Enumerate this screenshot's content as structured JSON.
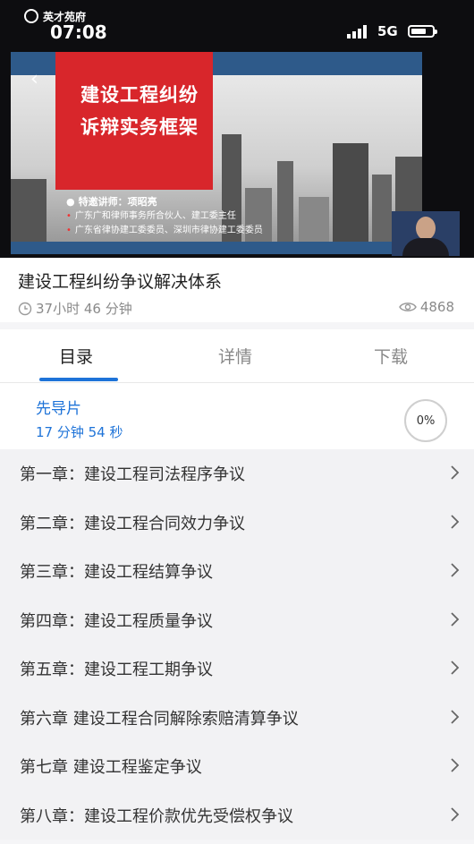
{
  "status_bar": {
    "app_logo_text": "英才苑府",
    "time": "07:08",
    "network": "5G"
  },
  "video": {
    "slide_title_line1": "建设工程纠纷",
    "slide_title_line2": "诉辩实务框架",
    "lecturer_label": "特邀讲师：项昭亮",
    "bullet1": "广东广和律师事务所合伙人、建工委主任",
    "bullet2": "广东省律协建工委委员、深圳市律协建工委委员"
  },
  "course": {
    "title": "建设工程纠纷争议解决体系",
    "duration": "37小时 46 分钟",
    "views": "4868"
  },
  "tabs": [
    {
      "label": "目录",
      "active": true
    },
    {
      "label": "详情",
      "active": false
    },
    {
      "label": "下载",
      "active": false
    }
  ],
  "current_item": {
    "title": "先导片",
    "duration": "17 分钟 54 秒",
    "progress": "0%"
  },
  "chapters": [
    "第一章：建设工程司法程序争议",
    "第二章：建设工程合同效力争议",
    "第三章：建设工程结算争议",
    "第四章：建设工程质量争议",
    "第五章：建设工程工期争议",
    "第六章 建设工程合同解除索赔清算争议",
    "第七章 建设工程鉴定争议",
    "第八章：建设工程价款优先受偿权争议"
  ],
  "colors": {
    "accent": "#1e73d8",
    "slide_red": "#d8262b",
    "slide_blue": "#2e5a8a"
  }
}
